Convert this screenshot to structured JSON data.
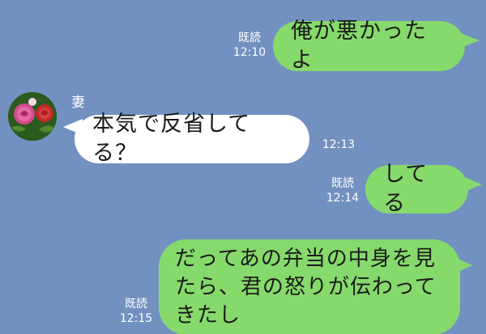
{
  "chat": {
    "messages": [
      {
        "side": "out",
        "text": "俺が悪かったよ",
        "read": "既読",
        "time": "12:10"
      },
      {
        "side": "in",
        "sender": "妻",
        "text": "本気で反省してる？",
        "time": "12:13"
      },
      {
        "side": "out",
        "text": "してる",
        "read": "既読",
        "time": "12:14"
      },
      {
        "side": "out",
        "text": "だってあの弁当の中身を見たら、君の怒りが伝わってきたし",
        "read": "既読",
        "time": "12:15"
      }
    ]
  },
  "colors": {
    "background": "#7291c1",
    "outgoing_bubble": "#86d96b",
    "incoming_bubble": "#ffffff"
  }
}
